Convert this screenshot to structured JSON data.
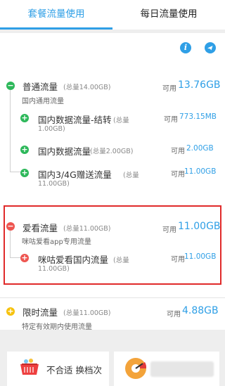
{
  "tabs": [
    {
      "label": "套餐流量使用",
      "active": true
    },
    {
      "label": "每日流量使用",
      "active": false
    }
  ],
  "icons": {
    "info": "info-icon",
    "send": "send-icon"
  },
  "groups": {
    "general": {
      "title": "普通流量",
      "total": "(总量14.00GB)",
      "desc": "国内通用流量",
      "avail_label": "可用",
      "avail_value": "13.76GB",
      "items": [
        {
          "title": "国内数据流量-结转",
          "total_a": "(总量",
          "total_b": "1.00GB)",
          "avail_label": "可用",
          "avail_value": "773.15MB"
        },
        {
          "title": "国内数据流量",
          "total_a": "(总量2.00GB)",
          "avail_label": "可用",
          "avail_value": "2.00GB"
        },
        {
          "title": "国内3/4G赠送流量",
          "total_a": "(总量",
          "total_b": "11.00GB)",
          "avail_label": "可用",
          "avail_value": "11.00GB"
        }
      ]
    },
    "aikan": {
      "title": "爱看流量",
      "total": "(总量11.00GB)",
      "desc": "咪咕爱看app专用流量",
      "avail_label": "可用",
      "avail_value": "11.00GB",
      "items": [
        {
          "title": "咪咕爱看国内流量",
          "total_a": "(总量",
          "total_b": "11.00GB)",
          "avail_label": "可用",
          "avail_value": "11.00GB"
        }
      ]
    },
    "limited": {
      "title": "限时流量",
      "total": "(总量11.00GB)",
      "desc": "特定有效期内使用流量",
      "avail_label": "可用",
      "avail_value": "4.88GB"
    }
  },
  "bottom": {
    "left_label": "不合适 换档次",
    "left_icon": "basket-icon",
    "right_icon": "gauge-icon"
  },
  "colors": {
    "accent": "#2f9fe6",
    "green": "#2db85a",
    "red": "#ee5550",
    "yellow": "#f6c20e",
    "highlight": "#e02a2a"
  }
}
